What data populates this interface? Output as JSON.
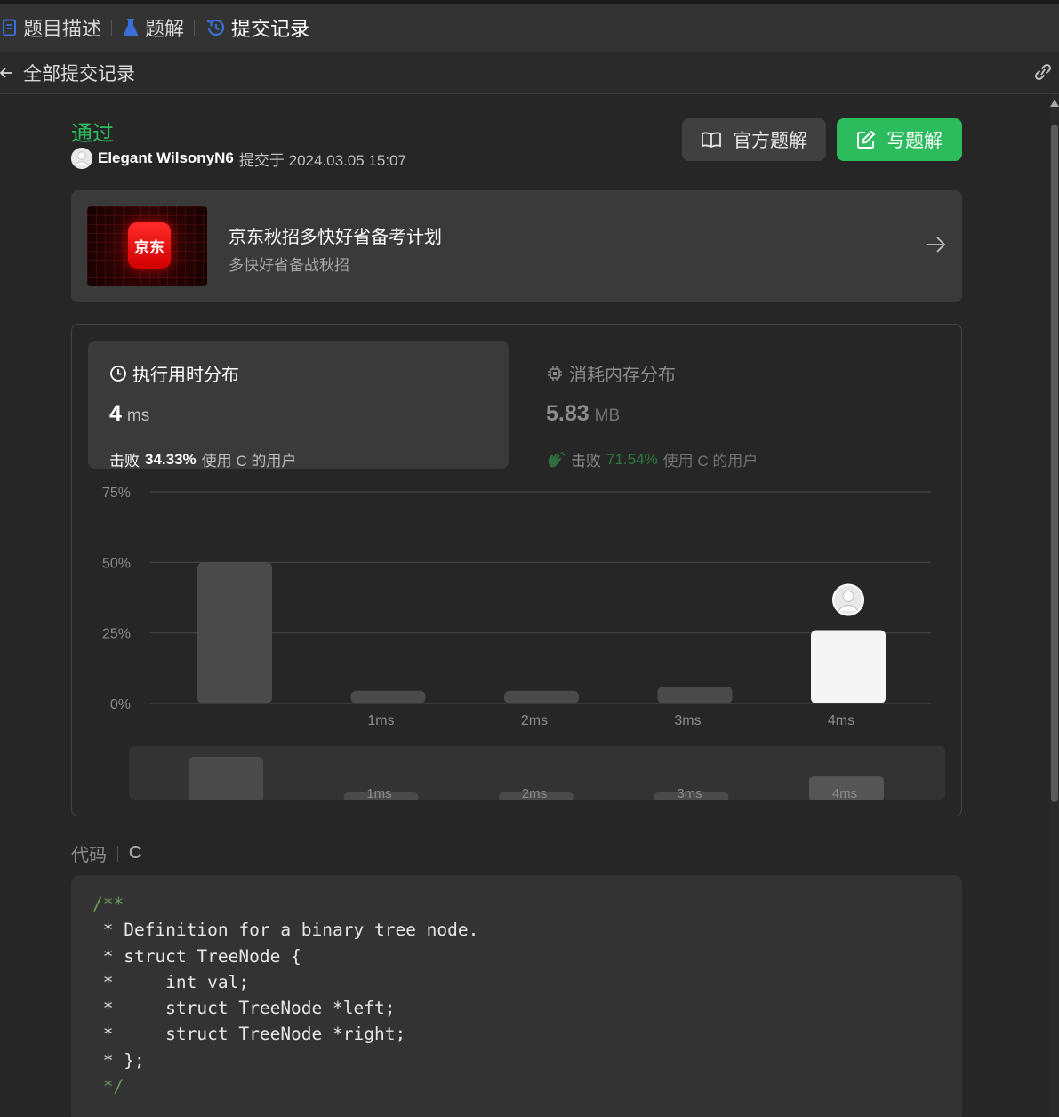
{
  "tabs": [
    {
      "label": "题目描述",
      "icon": "document-icon"
    },
    {
      "label": "题解",
      "icon": "flask-icon"
    },
    {
      "label": "提交记录",
      "icon": "history-icon",
      "active": true
    }
  ],
  "subbar": {
    "back_label": "全部提交记录"
  },
  "submission": {
    "status": "通过",
    "username": "Elegant WilsonyN6",
    "submitted_text": "提交于 2024.03.05 15:07"
  },
  "buttons": {
    "official": "官方题解",
    "write": "写题解"
  },
  "promo": {
    "logo_text": "京东",
    "title": "京东秋招多快好省备考计划",
    "subtitle": "多快好省备战秋招"
  },
  "runtime": {
    "title": "执行用时分布",
    "value": "4",
    "unit": "ms",
    "beat_prefix": "击败",
    "beat_pct": "34.33%",
    "beat_suffix": "使用 C 的用户"
  },
  "memory": {
    "title": "消耗内存分布",
    "value": "5.83",
    "unit": "MB",
    "beat_prefix": "击败",
    "beat_pct": "71.54%",
    "beat_suffix": "使用 C 的用户"
  },
  "chart_data": {
    "type": "bar",
    "categories": [
      "",
      "1ms",
      "2ms",
      "3ms",
      "4ms"
    ],
    "values": [
      50,
      4.5,
      4.5,
      6,
      26
    ],
    "yticks": [
      "75%",
      "50%",
      "25%",
      "0%"
    ],
    "ylim": [
      0,
      75
    ],
    "highlight_category": "4ms",
    "colors": {
      "bar": "#4a4a4a",
      "highlight": "#f5f5f5",
      "grid": "#444444"
    }
  },
  "code": {
    "label": "代码",
    "language": "C",
    "lines": [
      "/**",
      " * Definition for a binary tree node.",
      " * struct TreeNode {",
      " *     int val;",
      " *     struct TreeNode *left;",
      " *     struct TreeNode *right;",
      " * };",
      " */"
    ]
  },
  "colors": {
    "accent": "#2cbb5d",
    "background": "#262626",
    "card": "#3a3a3a"
  }
}
